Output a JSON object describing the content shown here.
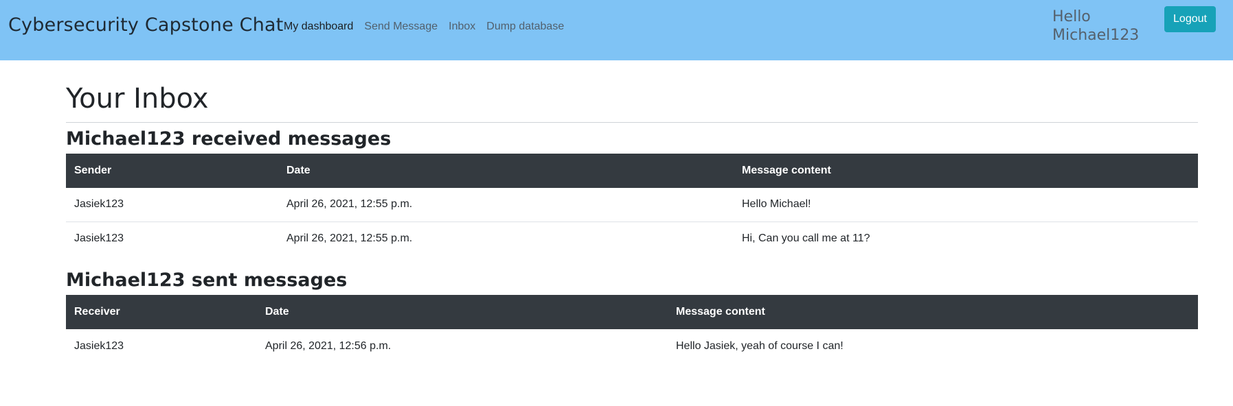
{
  "navbar": {
    "brand": "Cybersecurity Capstone Chat",
    "links": [
      "My dashboard",
      "Send Message",
      "Inbox",
      "Dump database"
    ],
    "greeting": "Hello Michael123",
    "logout_label": "Logout"
  },
  "main": {
    "page_title": "Your Inbox",
    "received": {
      "username": "Michael123",
      "suffix": "received messages",
      "headers": [
        "Sender",
        "Date",
        "Message content"
      ],
      "rows": [
        [
          "Jasiek123",
          "April 26, 2021, 12:55 p.m.",
          "Hello Michael!"
        ],
        [
          "Jasiek123",
          "April 26, 2021, 12:55 p.m.",
          "Hi, Can you call me at 11?"
        ]
      ]
    },
    "sent": {
      "username": "Michael123",
      "suffix": "sent messages",
      "headers": [
        "Receiver",
        "Date",
        "Message content"
      ],
      "rows": [
        [
          "Jasiek123",
          "April 26, 2021, 12:56 p.m.",
          "Hello Jasiek, yeah of course I can!"
        ]
      ]
    }
  },
  "colors": {
    "navbar_bg": "#7fc3f5",
    "table_header_bg": "#343a40",
    "logout_bg": "#17a2b8"
  }
}
